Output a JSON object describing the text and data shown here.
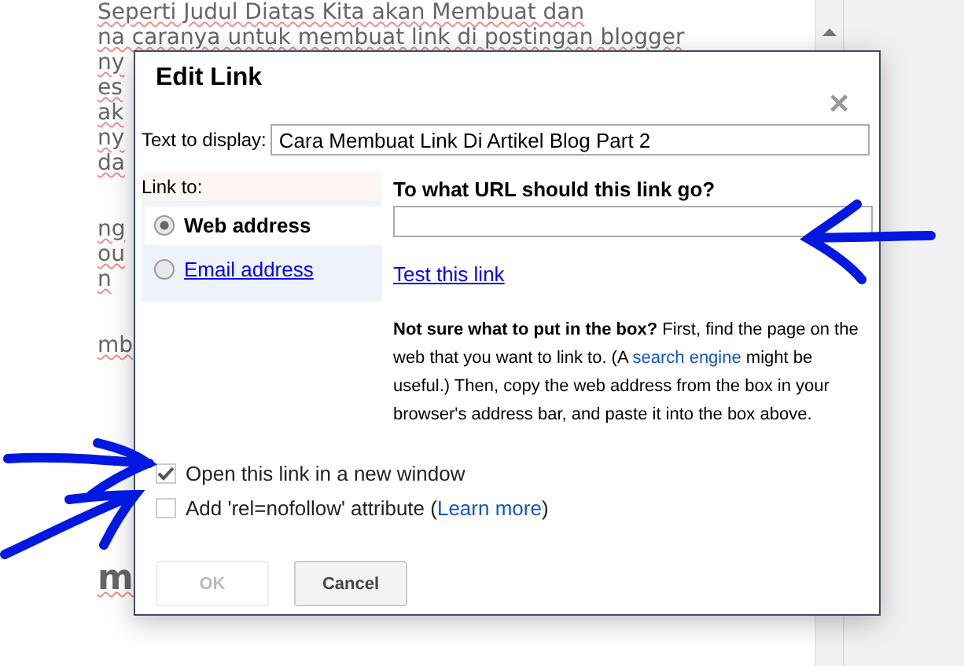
{
  "document": {
    "paragraphs": [
      {
        "kind": "text",
        "lines": [
          "Seperti Judul Diatas Kita akan Membuat dan",
          "na caranya untuk membuat link di postingan blogger",
          "ny",
          "es",
          "ak",
          "ny",
          "da"
        ]
      },
      {
        "kind": "text",
        "lines": [
          "ng",
          "ou",
          "n"
        ]
      },
      {
        "kind": "text",
        "lines": [
          "mb"
        ]
      },
      {
        "kind": "heading",
        "lines": [
          "m"
        ]
      }
    ]
  },
  "dialog": {
    "title": "Edit Link",
    "close": "×",
    "text_to_display": {
      "label": "Text to display:",
      "value": "Cara Membuat Link Di Artikel Blog Part 2"
    },
    "link_to": {
      "label": "Link to:",
      "options": [
        {
          "label": "Web address",
          "selected": true
        },
        {
          "label": "Email address",
          "selected": false
        }
      ]
    },
    "url": {
      "heading": "To what URL should this link go?",
      "test_link": "Test this link"
    },
    "help": "**Not sure what to put in the box?** First, find the page on the web that you want to link to. (A ",
    "help_link": "search engine",
    "help_end": " might be useful.) Then, copy the web address from the box in your browser's address bar, and paste it into the box above.",
    "options": [
      {
        "label": "Open this link in a new window",
        "checked": true
      },
      {
        "label": "Add 'rel=nofollow' attribute (",
        "link": "Learn more",
        "after": ")",
        "checked": false
      }
    ],
    "buttons": [
      {
        "label": "OK",
        "disabled": true
      },
      {
        "label": "Cancel",
        "disabled": false
      }
    ]
  }
}
